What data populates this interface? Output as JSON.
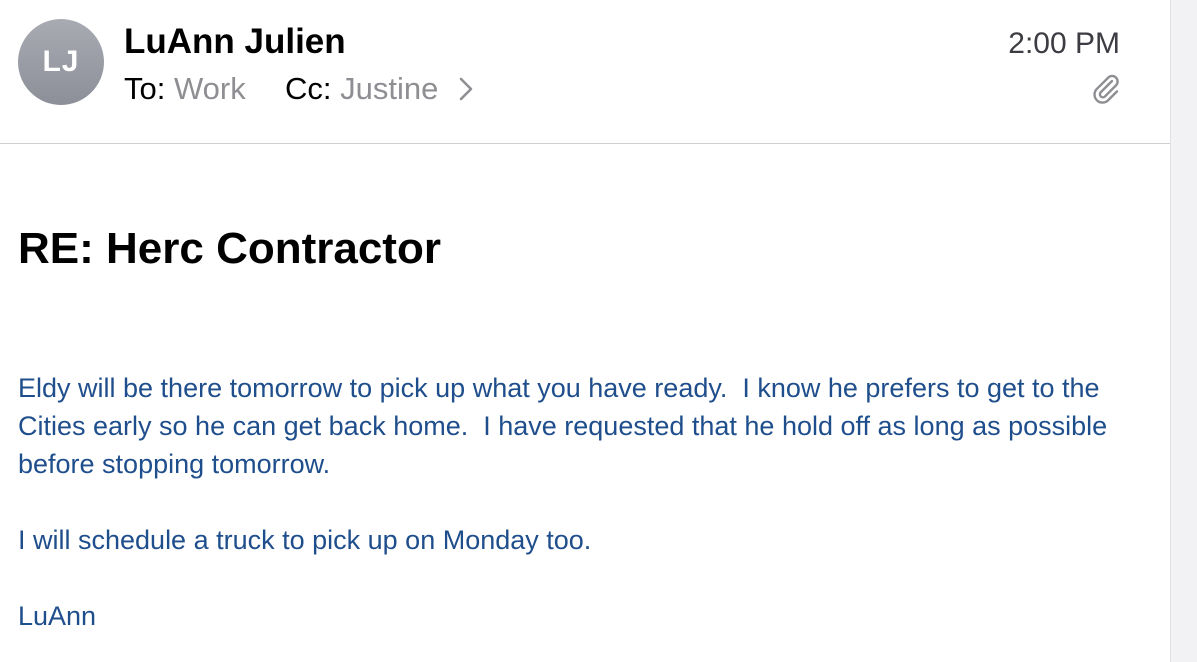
{
  "message": {
    "avatar_initials": "LJ",
    "sender_name": "LuAnn Julien",
    "to_label": "To:",
    "to_value": "Work",
    "cc_label": "Cc:",
    "cc_value": "Justine",
    "time": "2:00 PM",
    "has_attachment": true,
    "subject": "RE: Herc Contractor",
    "body": {
      "paragraph1": "Eldy will be there tomorrow to pick up what you have ready.  I know he prefers to get to the Cities early so he can get back home.  I have requested that he hold off as long as possible before stopping tomorrow.",
      "paragraph2": "I will schedule a truck to pick up on Monday too.",
      "signature": "LuAnn"
    }
  },
  "colors": {
    "body_text": "#1f4e8c",
    "secondary_text": "#8e8e93",
    "avatar_bg": "#9a9ca4"
  },
  "icons": {
    "attachment": "paperclip-icon",
    "disclosure": "chevron-right-icon"
  }
}
